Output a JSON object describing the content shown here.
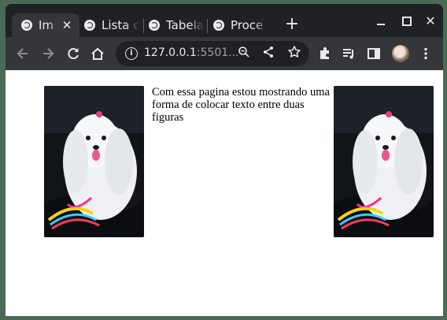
{
  "browser": {
    "tabs": [
      {
        "title": "Im",
        "active": true
      },
      {
        "title": "Lista c",
        "active": false
      },
      {
        "title": "Tabela",
        "active": false
      },
      {
        "title": "Proce",
        "active": false
      }
    ],
    "new_tab_glyph": "+",
    "close_glyph": "✕",
    "address": {
      "host": "127.0.0.1",
      "rest": ":5501..."
    },
    "icons": {
      "back": "back-arrow-icon",
      "forward": "forward-arrow-icon",
      "reload": "reload-icon",
      "home": "home-icon",
      "info": "info-icon",
      "zoom": "zoom-out-icon",
      "share": "share-icon",
      "bookmark": "star-icon",
      "extensions": "puzzle-icon",
      "media": "media-control-icon",
      "sidepanel": "side-panel-icon",
      "menu": "kebab-menu-icon"
    },
    "theme": {
      "frame": "#202124",
      "toolbar": "#35363a",
      "text": "#e8eaed"
    }
  },
  "page": {
    "text": "Com essa pagina estou mostrando uma forma de colocar texto entre duas figuras",
    "images": [
      {
        "subject": "white maltese dog on car seat",
        "position": "left"
      },
      {
        "subject": "white maltese dog on car seat",
        "position": "right"
      }
    ]
  }
}
